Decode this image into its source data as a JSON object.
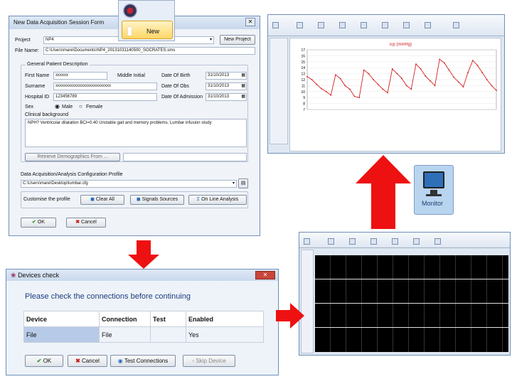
{
  "session_form": {
    "title": "New Data Acquisition Session Form",
    "project_label": "Project",
    "project_value": "NP4",
    "new_project_button": "New Project",
    "file_name_label": "File Name:",
    "file_name_value": "C:\\Users\\mare\\Documents\\NP4_20131031140500_SOCRATES.sms",
    "general_patient_group": "General Patient Description",
    "first_name_label": "First Name",
    "first_name_value": "xxxxxx",
    "middle_initial_label": "Middle Initial",
    "surname_label": "Surname",
    "surname_value": "xxxxxxxxxxxxxxxxxxxxxxxxxx",
    "hospital_id_label": "Hospital ID",
    "hospital_id_value": "123456789",
    "date_of_birth_label": "Date Of Birth",
    "date_of_birth_value": "31/10/2013",
    "date_of_obs_label": "Date Of Obs",
    "date_of_obs_value": "31/10/2013",
    "date_of_admission_label": "Date Of Admission",
    "date_of_admission_value": "31/10/2013",
    "sex_label": "Sex",
    "sex_male": "Male",
    "sex_female": "Female",
    "clinical_background_label": "Clinical background",
    "clinical_background_text": "NPH? Ventricular dilatation BCI=0.40 Unstable gait and memory problems. Lumbar infusion study",
    "retrieve_demographics_button": "Retrieve Demographics From ...",
    "config_group": "Data Acquisition/Analysis Configuration Profile",
    "config_value": "C:\\Users\\mare\\Desktop\\lumbar.cfg",
    "customise_label": "Customise the profile",
    "clear_all_button": "Clear All",
    "signals_sources_button": "Signals Sources",
    "online_analysis_button": "On Line Analysis",
    "ok_button": "OK",
    "cancel_button": "Cancel"
  },
  "new_popup": {
    "label": "New"
  },
  "monitor_button": {
    "label": "Monitor"
  },
  "devices_dialog": {
    "title": "Devices check",
    "message": "Please check the connections before continuing",
    "columns": [
      "Device",
      "Connection",
      "Test",
      "Enabled"
    ],
    "rows": [
      {
        "device": "File",
        "connection": "File",
        "test": "",
        "enabled": "Yes"
      }
    ],
    "ok_button": "OK",
    "cancel_button": "Cancel",
    "test_connections_button": "Test Connections",
    "skip_device_button": "Skip Device"
  },
  "analysis_window": {
    "chart_title": "icp (mmHg)"
  },
  "chart_data": {
    "type": "line",
    "title": "icp (mmHg)",
    "xlabel": "",
    "ylabel": "",
    "ylim": [
      7,
      17
    ],
    "y_ticks": [
      17,
      16,
      15,
      14,
      13,
      12,
      11,
      10,
      9,
      8,
      7
    ],
    "x": [
      0,
      1,
      2,
      3,
      4,
      5,
      6,
      7,
      8,
      9,
      10,
      11,
      12,
      13,
      14,
      15,
      16,
      17,
      18,
      19,
      20,
      21,
      22,
      23,
      24,
      25,
      26,
      27,
      28,
      29,
      30,
      31,
      32,
      33,
      34,
      35,
      36,
      37,
      38,
      39,
      40
    ],
    "series": [
      {
        "values": [
          12.5,
          12.0,
          11.2,
          10.5,
          10.0,
          9.4,
          12.8,
          12.2,
          11.0,
          10.4,
          9.2,
          9.0,
          13.6,
          13.0,
          12.0,
          11.2,
          10.4,
          9.8,
          13.8,
          13.0,
          12.2,
          11.0,
          10.4,
          14.6,
          13.8,
          12.6,
          11.8,
          11.0,
          15.4,
          14.8,
          13.6,
          12.4,
          11.6,
          10.8,
          13.2,
          15.2,
          14.4,
          13.2,
          12.0,
          11.0,
          10.2
        ]
      }
    ],
    "colors": {
      "line": "#d42020"
    }
  },
  "colors": {
    "arrow": "#ee1111",
    "monitor_bg": "#b8d4ef",
    "selected_row": "#b7cbe8"
  }
}
